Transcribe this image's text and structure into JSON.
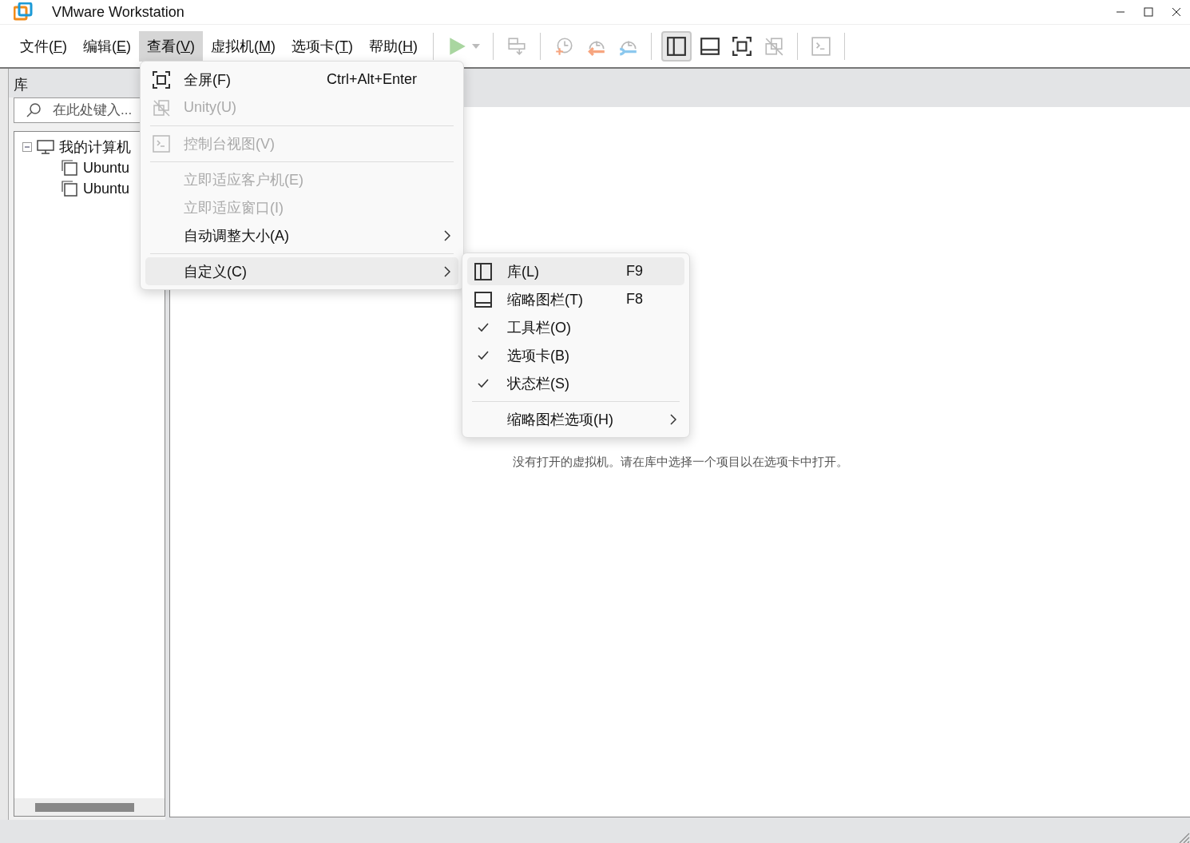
{
  "window": {
    "title": "VMware Workstation"
  },
  "menubar": [
    {
      "label": "文件(F)",
      "selected": false
    },
    {
      "label": "编辑(E)",
      "selected": false
    },
    {
      "label": "查看(V)",
      "selected": true
    },
    {
      "label": "虚拟机(M)",
      "selected": false
    },
    {
      "label": "选项卡(T)",
      "selected": false
    },
    {
      "label": "帮助(H)",
      "selected": false
    }
  ],
  "toolbar": [
    {
      "kind": "play",
      "disabled": true,
      "selected": false
    },
    {
      "kind": "separator"
    },
    {
      "kind": "send-keys",
      "disabled": true,
      "selected": false
    },
    {
      "kind": "separator"
    },
    {
      "kind": "snapshot-take",
      "disabled": true,
      "selected": false
    },
    {
      "kind": "snapshot-revert",
      "disabled": true,
      "selected": false
    },
    {
      "kind": "snapshot-manage",
      "disabled": true,
      "selected": false
    },
    {
      "kind": "separator"
    },
    {
      "kind": "view-library",
      "disabled": false,
      "selected": true
    },
    {
      "kind": "view-thumbnail",
      "disabled": false,
      "selected": false
    },
    {
      "kind": "view-fullscreen",
      "disabled": false,
      "selected": false
    },
    {
      "kind": "view-unity",
      "disabled": true,
      "selected": false
    },
    {
      "kind": "separator"
    },
    {
      "kind": "console",
      "disabled": true,
      "selected": false
    },
    {
      "kind": "separator"
    }
  ],
  "sidebar": {
    "title": "库",
    "search": {
      "placeholder": "在此处键入..."
    },
    "tree": [
      {
        "kind": "computer",
        "label": "我的计算机",
        "expanded": true,
        "children": [
          {
            "kind": "vm",
            "label": "Ubuntu"
          },
          {
            "kind": "vm",
            "label": "Ubuntu"
          }
        ]
      }
    ]
  },
  "main": {
    "message": "没有打开的虚拟机。请在库中选择一个项目以在选项卡中打开。"
  },
  "view_menu": [
    {
      "kind": "fullscreen",
      "label": "全屏(F)",
      "shortcut": "Ctrl+Alt+Enter",
      "disabled": false,
      "selected": false,
      "has_submenu": false
    },
    {
      "kind": "unity",
      "label": "Unity(U)",
      "disabled": true,
      "selected": false,
      "has_submenu": false
    },
    {
      "kind": "separator"
    },
    {
      "kind": "console",
      "label": "控制台视图(V)",
      "disabled": true,
      "selected": false,
      "has_submenu": false
    },
    {
      "kind": "separator"
    },
    {
      "kind": "item",
      "label": "立即适应客户机(E)",
      "disabled": true,
      "selected": false,
      "has_submenu": false
    },
    {
      "kind": "item",
      "label": "立即适应窗口(I)",
      "disabled": true,
      "selected": false,
      "has_submenu": false
    },
    {
      "kind": "item",
      "label": "自动调整大小(A)",
      "disabled": false,
      "selected": false,
      "has_submenu": true
    },
    {
      "kind": "separator"
    },
    {
      "kind": "item",
      "label": "自定义(C)",
      "disabled": false,
      "selected": true,
      "has_submenu": true
    }
  ],
  "customize_submenu": [
    {
      "kind": "library",
      "label": "库(L)",
      "shortcut": "F9",
      "checked": false,
      "selected": true,
      "has_submenu": false
    },
    {
      "kind": "thumbnail",
      "label": "缩略图栏(T)",
      "shortcut": "F8",
      "checked": false,
      "selected": false,
      "has_submenu": false
    },
    {
      "kind": "item",
      "label": "工具栏(O)",
      "checked": true,
      "selected": false,
      "has_submenu": false
    },
    {
      "kind": "item",
      "label": "选项卡(B)",
      "checked": true,
      "selected": false,
      "has_submenu": false
    },
    {
      "kind": "item",
      "label": "状态栏(S)",
      "checked": true,
      "selected": false,
      "has_submenu": false
    },
    {
      "kind": "separator"
    },
    {
      "kind": "item",
      "label": "缩略图栏选项(H)",
      "checked": false,
      "selected": false,
      "has_submenu": true
    }
  ]
}
